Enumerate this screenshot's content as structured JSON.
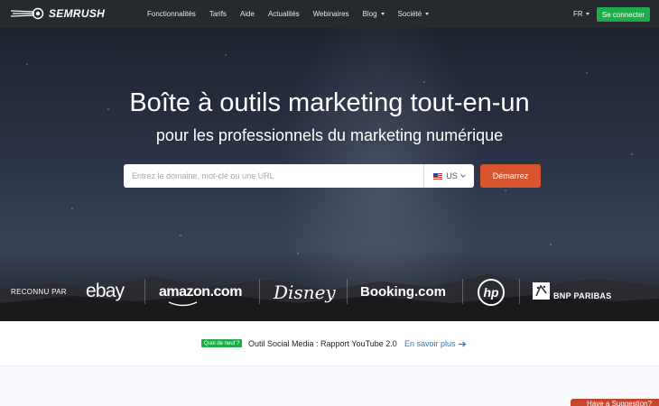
{
  "nav": {
    "logo_text": "SEMRUSH",
    "menu": [
      {
        "label": "Fonctionnalités",
        "has_caret": false
      },
      {
        "label": "Tarifs",
        "has_caret": false
      },
      {
        "label": "Aide",
        "has_caret": false
      },
      {
        "label": "Actualités",
        "has_caret": false
      },
      {
        "label": "Webinaires",
        "has_caret": false
      },
      {
        "label": "Blog",
        "has_caret": true
      },
      {
        "label": "Société",
        "has_caret": true
      }
    ],
    "language": "FR",
    "connect_label": "Se connecter"
  },
  "hero": {
    "title": "Boîte à outils marketing tout-en-un",
    "subtitle": "pour les professionnels du marketing numérique",
    "search_placeholder": "Entrez le domaine, mot-clé ou une URL",
    "database": "US",
    "submit_label": "Démarrez"
  },
  "logos": {
    "recognized_label": "RECONNU PAR",
    "brands": [
      "ebay",
      "amazon.com",
      "Disney",
      "Booking.com",
      "hp",
      "BNP PARIBAS"
    ]
  },
  "banner": {
    "badge": "Quoi de neuf ?",
    "text": "Outil Social Media : Rapport YouTube 2.0",
    "link": "En savoir plus"
  },
  "support": {
    "label": "Have a Suggestion?"
  },
  "colors": {
    "nav_bg": "#26292d",
    "connect_button": "#1cad4a",
    "start_button": "#d8542f",
    "link": "#2a7bc0",
    "support_tab": "#c6452d"
  }
}
